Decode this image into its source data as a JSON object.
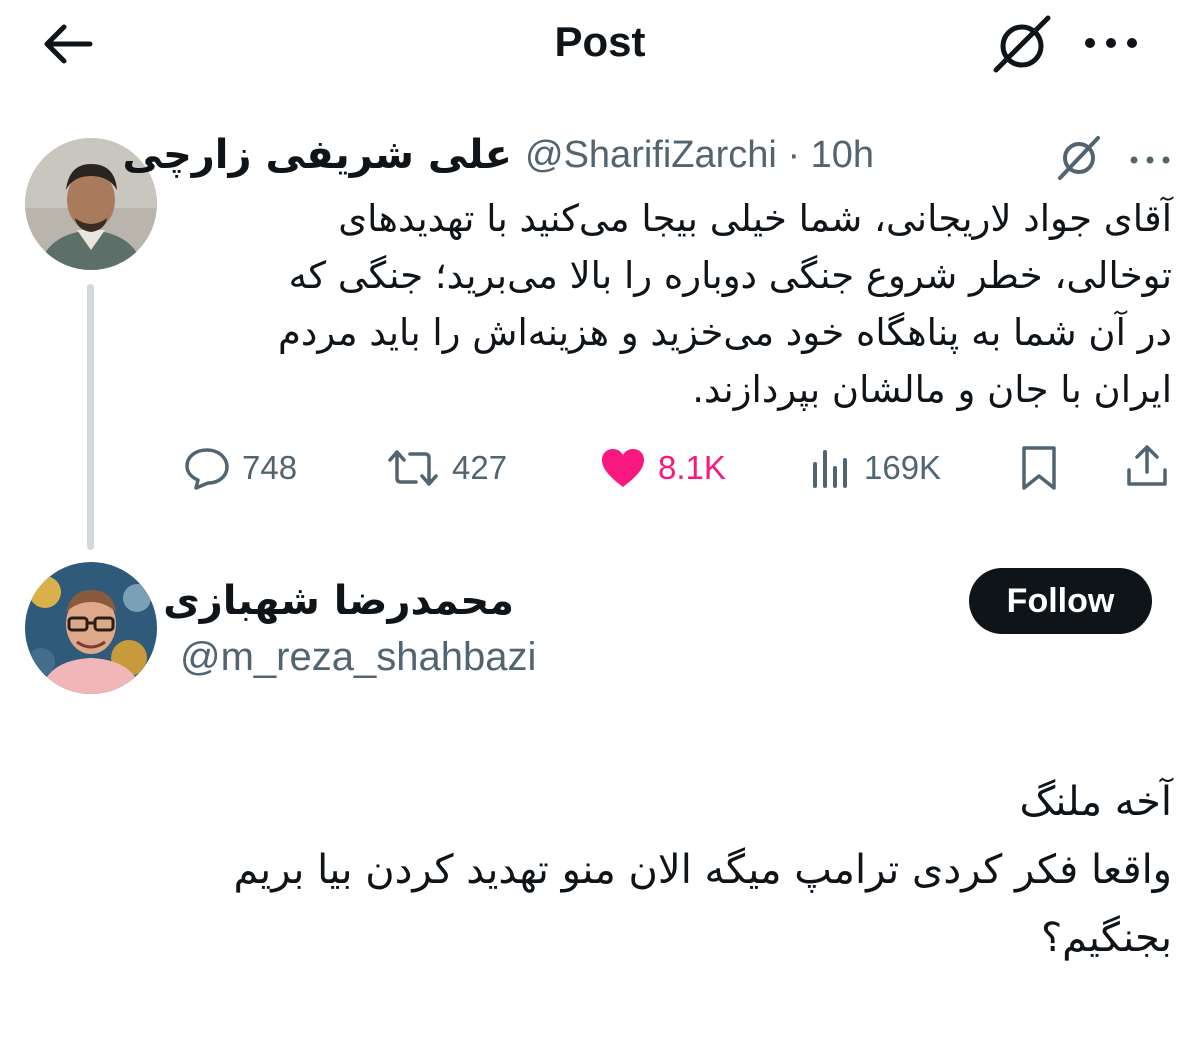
{
  "header": {
    "title": "Post",
    "back_icon": "arrow-left-icon",
    "grok_icon": "grok-icon",
    "more_icon": "more-horizontal-icon"
  },
  "original_post": {
    "author_name": "علی شریفی زارچی",
    "handle": "@SharifiZarchi",
    "separator": "·",
    "time": "10h",
    "avatar_icon": "avatar-photo",
    "body_lines": [
      "آقای جواد لاریجانی، شما خیلی بیجا می‌کنید با تهدیدهای",
      "توخالی، خطر شروع جنگی دوباره را بالا می‌برید؛ جنگی که",
      "در آن شما به پناهگاه خود می‌خزید و هزینه‌اش را باید مردم",
      "ایران با جان و مالشان بپردازند."
    ],
    "actions": {
      "replies": "748",
      "reposts": "427",
      "likes": "8.1K",
      "views": "169K"
    },
    "like_color": "#f91880"
  },
  "reply_post": {
    "author_name": "محمدرضا شهبازی",
    "handle": "@m_reza_shahbazi",
    "follow_label": "Follow",
    "avatar_icon": "avatar-photo",
    "body_lines": [
      "آخه ملنگ",
      "واقعا فکر کردی ترامپ میگه الان منو تهدید کردن بیا بریم",
      "بجنگیم؟"
    ]
  }
}
